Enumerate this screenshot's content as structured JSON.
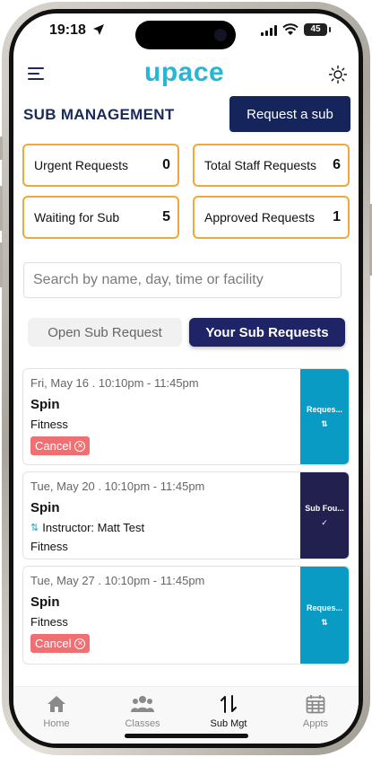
{
  "status_bar": {
    "time": "19:18",
    "battery": "45"
  },
  "header": {
    "logo": "upace"
  },
  "page": {
    "title": "SUB MANAGEMENT",
    "request_button": "Request a sub"
  },
  "stats": [
    {
      "label": "Urgent Requests",
      "value": "0"
    },
    {
      "label": "Total Staff Requests",
      "value": "6"
    },
    {
      "label": "Waiting for Sub",
      "value": "5"
    },
    {
      "label": "Approved Requests",
      "value": "1"
    }
  ],
  "search": {
    "placeholder": "Search by name, day, time or facility"
  },
  "tabs": [
    {
      "label": "Open Sub Request",
      "active": false
    },
    {
      "label": "Your Sub Requests",
      "active": true
    }
  ],
  "cards": [
    {
      "date": "Fri, May 16 . 10:10pm - 11:45pm",
      "class": "Spin",
      "facility": "Fitness",
      "cancel": "Cancel",
      "status": "Reques...",
      "status_color": "#0a9bc4"
    },
    {
      "date": "Tue, May 20 . 10:10pm - 11:45pm",
      "class": "Spin",
      "instructor": "Instructor: Matt Test",
      "facility": "Fitness",
      "status": "Sub Fou...",
      "status_color": "#22204f"
    },
    {
      "date": "Tue, May 27 . 10:10pm - 11:45pm",
      "class": "Spin",
      "facility": "Fitness",
      "cancel": "Cancel",
      "status": "Reques...",
      "status_color": "#0a9bc4"
    }
  ],
  "nav": [
    {
      "label": "Home",
      "icon": "home-icon",
      "active": false
    },
    {
      "label": "Classes",
      "icon": "people-icon",
      "active": false
    },
    {
      "label": "Sub Mgt",
      "icon": "swap-icon",
      "active": true
    },
    {
      "label": "Appts",
      "icon": "calendar-icon",
      "active": false
    }
  ],
  "colors": {
    "brand": "#29b6d6",
    "navy": "#15245b",
    "stat_border": "#f0a83a",
    "cancel": "#ef6f72"
  }
}
